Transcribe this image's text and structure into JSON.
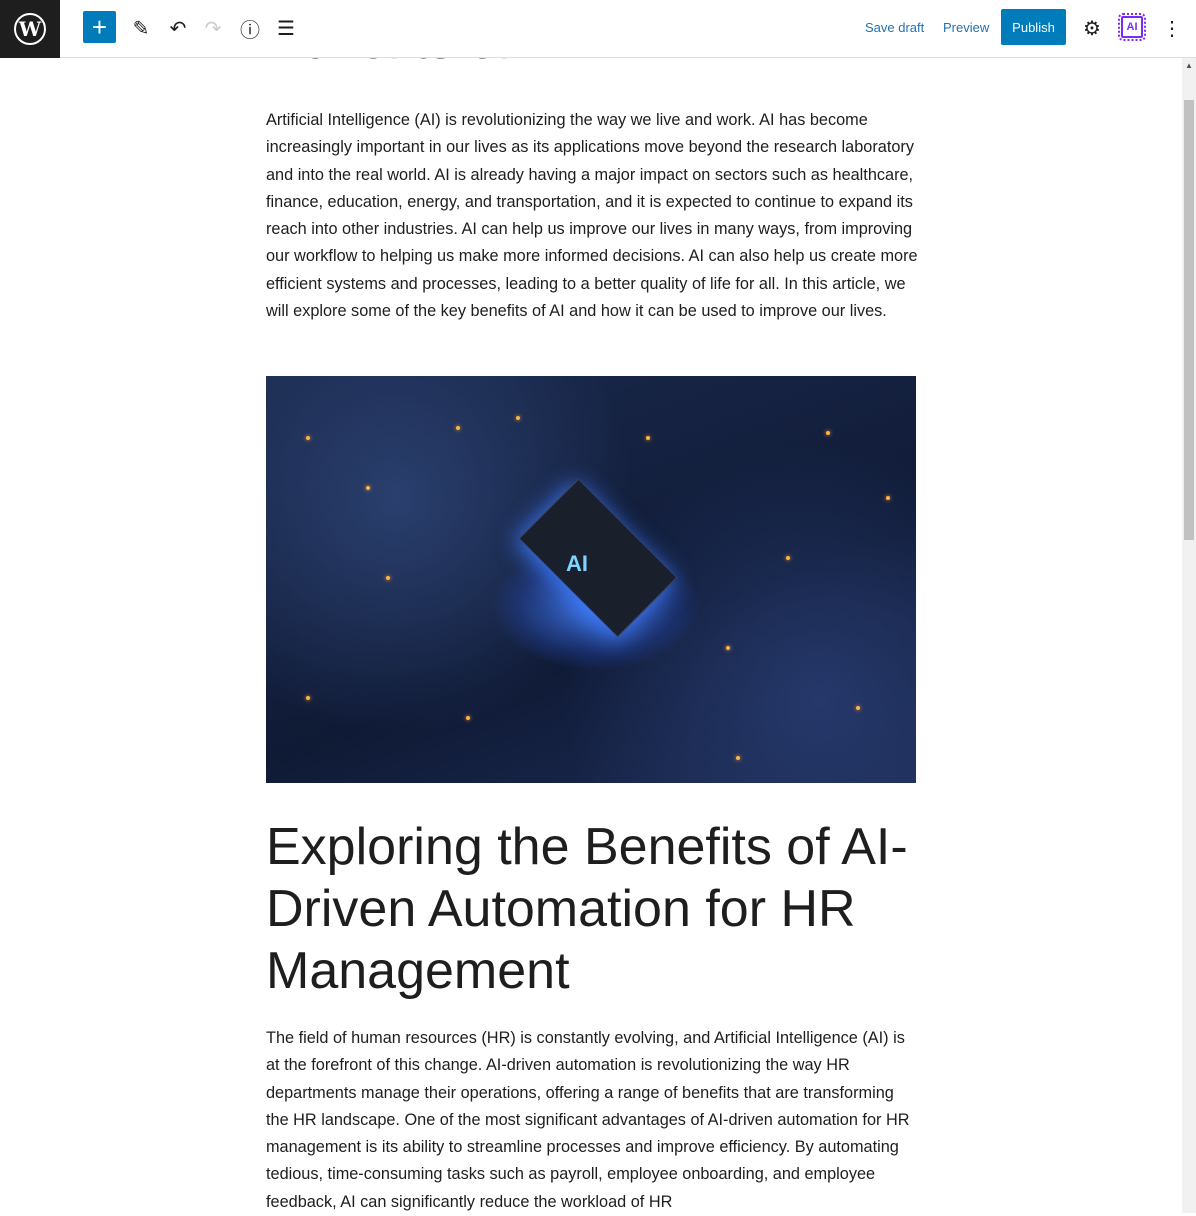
{
  "toolbar": {
    "logo": "W",
    "add_label": "+",
    "save_draft": "Save draft",
    "preview": "Preview",
    "publish": "Publish",
    "ai_badge": "AI",
    "icons": [
      "wordpress-logo",
      "plus-icon",
      "pencil-icon",
      "undo-icon",
      "redo-icon",
      "info-icon",
      "list-view-icon",
      "gear-icon",
      "ai-chip-icon",
      "more-vertical-icon"
    ]
  },
  "post": {
    "top_heading": "Benefits of AI",
    "intro": "Artificial Intelligence (AI) is revolutionizing the way we live and work. AI has become increasingly important in our lives as its applications move beyond the research laboratory and into the real world. AI is already having a major impact on sectors such as healthcare, finance, education, energy, and transportation, and it is expected to continue to expand its reach into other industries. AI can help us improve our lives in many ways, from improving our workflow to helping us make more informed decisions. AI can also help us create more efficient systems and processes, leading to a better quality of life for all. In this article, we will explore some of the key benefits of AI and how it can be used to improve our lives.",
    "image_label": "AI",
    "heading2": "Exploring the Benefits of AI-Driven Automation for HR Management",
    "paragraph2": " The field of human resources (HR) is constantly evolving, and Artificial Intelligence (AI) is at the forefront of this change. AI-driven automation is revolutionizing the way HR departments manage their operations, offering a range of benefits that are transforming the HR landscape. One of the most significant advantages of AI-driven automation for HR management is its ability to streamline processes and improve efficiency. By automating tedious, time-consuming tasks such as payroll, employee onboarding, and employee feedback, AI can significantly reduce the workload of HR"
  }
}
